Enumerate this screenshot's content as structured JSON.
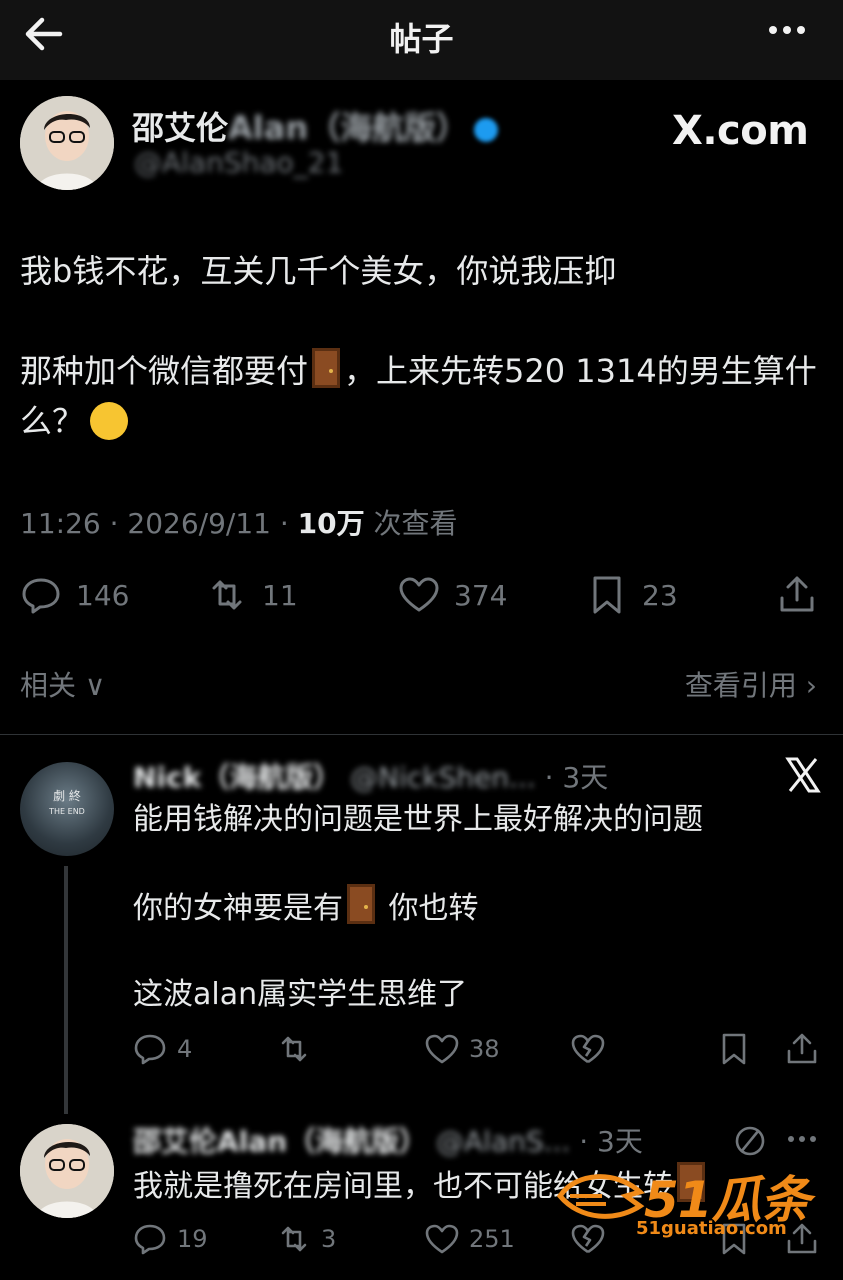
{
  "header": {
    "title": "帖子"
  },
  "post": {
    "author_name": "邵艾伦Alan（海航版）",
    "author_handle": "@AlanShao_21",
    "brand": "X.com",
    "paragraphs": [
      "我b钱不花，互关几千个美女，你说我压抑",
      "那种加个微信都要付",
      "，上来先转520 1314的男生算什么？"
    ],
    "time": "11:26 · 2026/9/11 · ",
    "views_count": "10万",
    "views_label": " 次查看",
    "replies": "146",
    "reposts": "11",
    "likes": "374",
    "bookmarks": "23",
    "related_label": "相关",
    "quotes_label": "查看引用"
  },
  "replies": [
    {
      "name": "Nick（海航版）",
      "handle": "@NickShen...",
      "time": "3天",
      "lines": [
        "能用钱解决的问题是世界上最好解决的问题",
        "你的女神要是有",
        "你也转",
        "这波alan属实学生思维了"
      ],
      "replies": "4",
      "reposts": "",
      "likes": "38"
    },
    {
      "name": "邵艾伦Alan（海航版）",
      "handle": "@AlanS...",
      "time": "3天",
      "text": "我就是撸死在房间里，也不可能给女生转",
      "replies": "19",
      "reposts": "3",
      "likes": "251"
    }
  ],
  "watermark": {
    "brand": "51瓜条",
    "url": "51guatiao.com"
  }
}
